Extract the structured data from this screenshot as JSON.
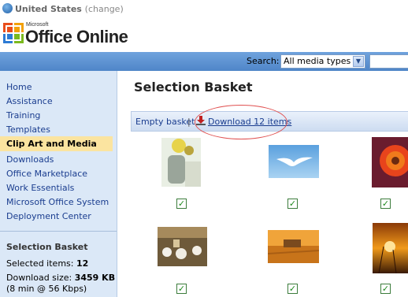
{
  "locale": {
    "country": "United States",
    "change": "(change)"
  },
  "header": {
    "brand_small": "Microsoft",
    "brand_large": "Office Online"
  },
  "search": {
    "label": "Search:",
    "selected": "All media types"
  },
  "sidebar": {
    "items": [
      {
        "label": "Home",
        "active": false
      },
      {
        "label": "Assistance",
        "active": false
      },
      {
        "label": "Training",
        "active": false
      },
      {
        "label": "Templates",
        "active": false
      },
      {
        "label": "Clip Art and Media",
        "active": true
      },
      {
        "label": "Downloads",
        "active": false
      },
      {
        "label": "Office Marketplace",
        "active": false
      },
      {
        "label": "Work Essentials",
        "active": false
      },
      {
        "label": "Microsoft Office System",
        "active": false
      },
      {
        "label": "Deployment Center",
        "active": false
      }
    ],
    "basket": {
      "title": "Selection Basket",
      "selected_label": "Selected items:",
      "selected_count": "12",
      "size_label": "Download size:",
      "size_value": "3459 KB",
      "time": "(8 min @ 56 Kbps)"
    }
  },
  "main": {
    "title": "Selection Basket",
    "empty_basket": "Empty basket",
    "separator": "|",
    "download": "Download 12 items",
    "thumbnails": [
      {
        "subject": "flower-vase-photo",
        "checked": true
      },
      {
        "subject": "bird-sky-photo",
        "checked": true
      },
      {
        "subject": "red-flower-photo",
        "checked": true
      },
      {
        "subject": "banquet-hall-photo",
        "checked": true
      },
      {
        "subject": "wheat-harvest-photo",
        "checked": true
      },
      {
        "subject": "sunset-field-photo",
        "checked": true
      }
    ]
  },
  "colors": {
    "accent": "#4f85c8",
    "link": "#1a3d8f",
    "sidebar_bg": "#dbe8f7",
    "active_bg": "#fbe4a0",
    "highlight": "#e05050"
  }
}
